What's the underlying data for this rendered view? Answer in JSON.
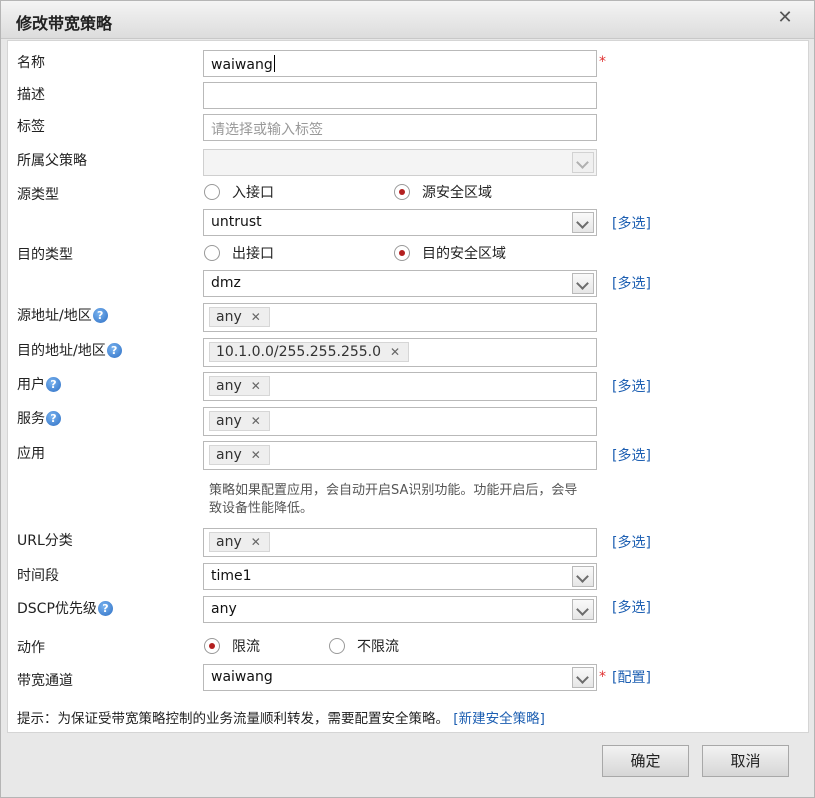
{
  "dialog": {
    "title": "修改带宽策略",
    "close": "✕"
  },
  "fields": {
    "name": {
      "label": "名称",
      "value": "waiwang",
      "required": "*"
    },
    "desc": {
      "label": "描述",
      "value": ""
    },
    "tag": {
      "label": "标签",
      "placeholder": "请选择或输入标签"
    },
    "parent": {
      "label": "所属父策略",
      "value": ""
    },
    "src_type": {
      "label": "源类型",
      "option_a": "入接口",
      "option_b": "源安全区域",
      "selected": "源安全区域"
    },
    "src_zone": {
      "value": "untrust",
      "link": "[多选]"
    },
    "dst_type": {
      "label": "目的类型",
      "option_a": "出接口",
      "option_b": "目的安全区域",
      "selected": "目的安全区域"
    },
    "dst_zone": {
      "value": "dmz",
      "link": "[多选]"
    },
    "src_addr": {
      "label": "源地址/地区",
      "tag": "any"
    },
    "dst_addr": {
      "label": "目的地址/地区",
      "tag": "10.1.0.0/255.255.255.0"
    },
    "user": {
      "label": "用户",
      "tag": "any",
      "link": "[多选]"
    },
    "service": {
      "label": "服务",
      "tag": "any"
    },
    "app": {
      "label": "应用",
      "tag": "any",
      "link": "[多选]",
      "hint": "策略如果配置应用，会自动开启SA识别功能。功能开启后，会导致设备性能降低。"
    },
    "url": {
      "label": "URL分类",
      "tag": "any",
      "link": "[多选]"
    },
    "schedule": {
      "label": "时间段",
      "value": "time1"
    },
    "dscp": {
      "label": "DSCP优先级",
      "value": "any",
      "link": "[多选]"
    },
    "action": {
      "label": "动作",
      "option_a": "限流",
      "option_b": "不限流",
      "selected": "限流"
    },
    "channel": {
      "label": "带宽通道",
      "value": "waiwang",
      "required": "*",
      "link": "[配置]"
    }
  },
  "tip": {
    "text": "提示：为保证受带宽策略控制的业务流量顺利转发，需要配置安全策略。",
    "link": "[新建安全策略]"
  },
  "buttons": {
    "ok": "确定",
    "cancel": "取消"
  },
  "help_glyph": "?",
  "remove_glyph": "✕",
  "colors": {
    "link": "#1d5fb2",
    "radio_selected": "#b31f1f",
    "required": "#e03030"
  }
}
